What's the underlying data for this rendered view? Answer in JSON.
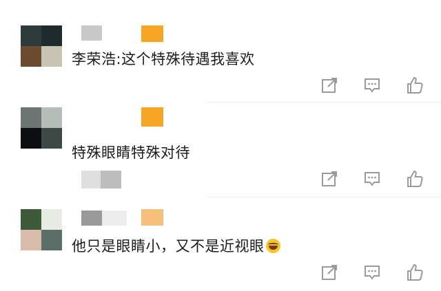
{
  "comments": [
    {
      "text": "李荣浩:这个特殊待遇我喜欢",
      "has_emoji": false
    },
    {
      "text": "特殊眼睛特殊对待",
      "has_emoji": false
    },
    {
      "text": "他只是眼睛小，又不是近视眼",
      "has_emoji": true,
      "emoji_icon": "laughing-tears-emoji-icon"
    }
  ],
  "actions": {
    "share_icon": "share-icon",
    "reply_icon": "comment-reply-icon",
    "like_icon": "thumbs-up-icon"
  },
  "colors": {
    "text": "#1c1c1c",
    "icon": "#9a9a9a",
    "accent_orange": "#f6a623"
  }
}
